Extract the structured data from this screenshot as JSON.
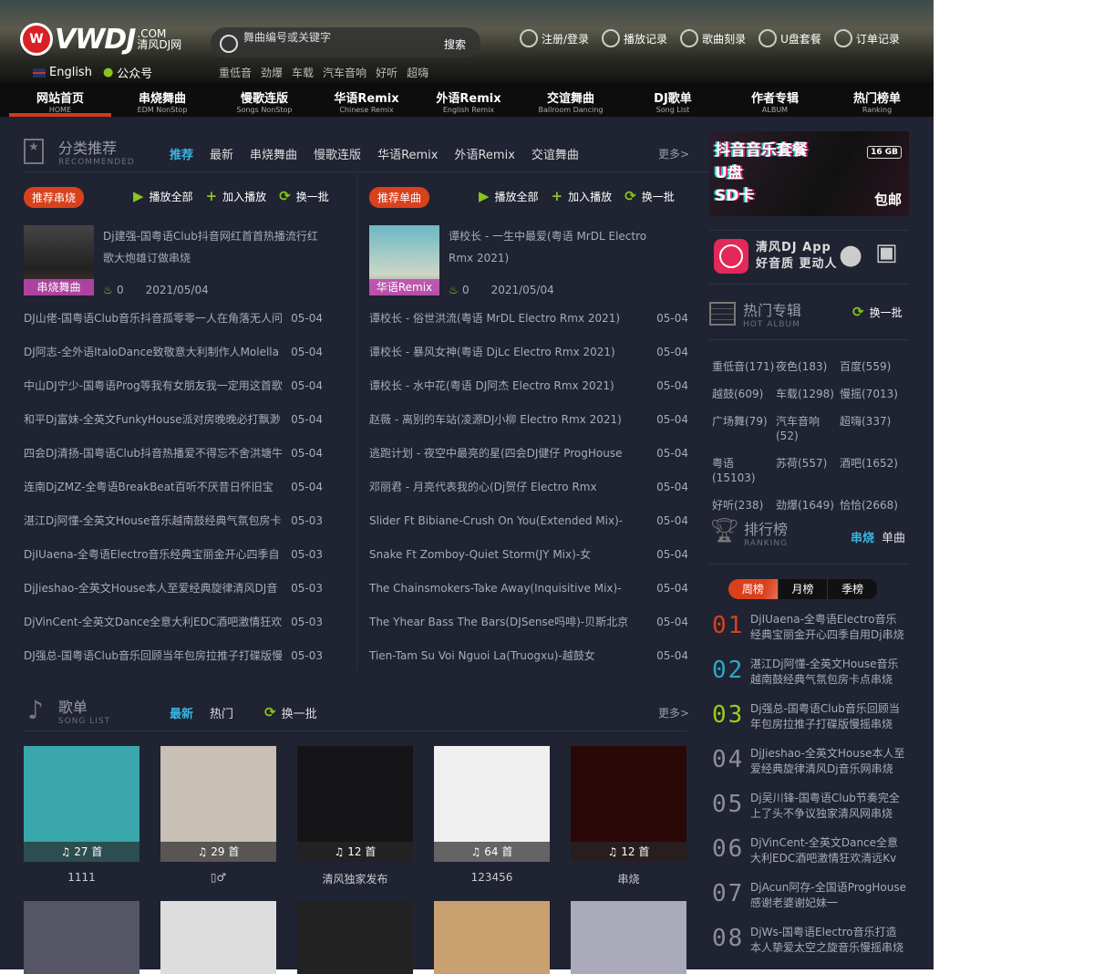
{
  "header": {
    "logo_text": "VWDJ",
    "logo_domain": ".COM",
    "logo_sub": "清风DJ网",
    "english": "English",
    "wechat": "公众号",
    "search": {
      "placeholder": "舞曲编号或关键字",
      "button": "搜索"
    },
    "hot_words": [
      "重低音",
      "劲爆",
      "车载",
      "汽车音响",
      "好听",
      "超嗨"
    ],
    "tools": [
      {
        "icon": "user-icon",
        "label": "注册/登录"
      },
      {
        "icon": "clock-icon",
        "label": "播放记录"
      },
      {
        "icon": "disc-icon",
        "label": "歌曲刻录"
      },
      {
        "icon": "usb-icon",
        "label": "U盘套餐"
      },
      {
        "icon": "order-icon",
        "label": "订单记录"
      }
    ]
  },
  "nav": [
    {
      "label": "网站首页",
      "sub": "HOME",
      "active": true
    },
    {
      "label": "串烧舞曲",
      "sub": "EDM NonStop"
    },
    {
      "label": "慢歌连版",
      "sub": "Songs NonStop"
    },
    {
      "label": "华语Remix",
      "sub": "Chinese Remix"
    },
    {
      "label": "外语Remix",
      "sub": "English Remix"
    },
    {
      "label": "交谊舞曲",
      "sub": "Ballroom Dancing"
    },
    {
      "label": "DJ歌单",
      "sub": "Song List"
    },
    {
      "label": "作者专辑",
      "sub": "ALBUM"
    },
    {
      "label": "热门榜单",
      "sub": "Ranking"
    }
  ],
  "recommend": {
    "title": "分类推荐",
    "subtitle": "RECOMMENDED",
    "tabs": [
      "推荐",
      "最新",
      "串烧舞曲",
      "慢歌连版",
      "华语Remix",
      "外语Remix",
      "交谊舞曲"
    ],
    "more": "更多>",
    "play_all": "播放全部",
    "add_play": "加入播放",
    "refresh": "换一批",
    "left": {
      "badge": "推荐串烧",
      "featured": {
        "title": "Dj建强-国粤语Club抖音网红首首热播流行红歌大炮雄订做串烧",
        "tag": "串烧舞曲",
        "hot": "0",
        "date": "2021/05/04"
      },
      "songs": [
        [
          "DJ山佬-国粤语Club音乐抖音孤零零一人在角落无人问",
          "05-04"
        ],
        [
          "DJ阿志-全外语ItaloDance致敬意大利制作人Molella",
          "05-04"
        ],
        [
          "中山DJ宁少-国粤语Prog等我有女朋友我一定用这首歌",
          "05-04"
        ],
        [
          "和平Dj富妹-全英文FunkyHouse派对房晚晚必打飘渺",
          "05-04"
        ],
        [
          "四会DJ清扬-国粤语Club抖音热播爱不得忘不舍洪塘牛",
          "05-04"
        ],
        [
          "连南DjZMZ-全粤语BreakBeat百听不厌昔日怀旧宝",
          "05-04"
        ],
        [
          "湛江Dj阿懂-全英文House音乐越南鼓经典气氛包房卡",
          "05-03"
        ],
        [
          "DjIUaena-全粤语Electro音乐经典宝丽金开心四季自",
          "05-03"
        ],
        [
          "DjJieshao-全英文House本人至爱经典旋律清风DJ音",
          "05-03"
        ],
        [
          "DjVinCent-全英文Dance全意大利EDC酒吧激情狂欢",
          "05-03"
        ],
        [
          "DJ强总-国粤语Club音乐回顾当年包房拉推子打碟版慢",
          "05-03"
        ]
      ]
    },
    "right": {
      "badge": "推荐单曲",
      "featured": {
        "title": "谭校长 - 一生中最爱(粤语 MrDL Electro Rmx 2021)",
        "tag": "华语Remix",
        "hot": "0",
        "date": "2021/05/04"
      },
      "songs": [
        [
          "谭校长 - 俗世洪流(粤语 MrDL Electro Rmx 2021)",
          "05-04"
        ],
        [
          "谭校长 - 暴风女神(粤语 DjLc Electro Rmx 2021)",
          "05-04"
        ],
        [
          "谭校长 - 水中花(粤语 DJ阿杰 Electro Rmx 2021)",
          "05-04"
        ],
        [
          "赵薇 - 离别的车站(凌源DJ小柳 Electro Rmx 2021)",
          "05-04"
        ],
        [
          "逃跑计划 - 夜空中最亮的星(四会DJ健仔 ProgHouse",
          "05-04"
        ],
        [
          "邓丽君 - 月亮代表我的心(Dj贺仔 Electro Rmx",
          "05-04"
        ],
        [
          "Slider Ft Bibiane-Crush On You(Extended Mix)-",
          "05-04"
        ],
        [
          "Snake Ft Zomboy-Quiet Storm(JY Mix)-女",
          "05-04"
        ],
        [
          "The Chainsmokers-Take Away(Inquisitive Mix)-",
          "05-04"
        ],
        [
          "The Yhear Bass The Bars(DJSense吗啡)-贝斯北京",
          "05-04"
        ],
        [
          "Tien-Tam Su Voi Nguoi La(Truogxu)-越鼓女",
          "05-04"
        ]
      ]
    }
  },
  "songlist": {
    "title": "歌单",
    "subtitle": "SONG LIST",
    "tabs": [
      "最新",
      "热门"
    ],
    "refresh": "换一批",
    "more": "更多>",
    "items": [
      {
        "count": "27 首",
        "name": "1111",
        "color": "#3aa7ad"
      },
      {
        "count": "29 首",
        "name": "▯♂",
        "color": "#c8bfb5"
      },
      {
        "count": "12 首",
        "name": "清风独家发布",
        "color": "#151518"
      },
      {
        "count": "64 首",
        "name": "123456",
        "color": "#f0f0f0"
      },
      {
        "count": "12 首",
        "name": "串烧",
        "color": "#2a0808"
      }
    ],
    "row2_colors": [
      "#556",
      "#ddd",
      "#222",
      "#c9a070",
      "#aab"
    ]
  },
  "sidebar": {
    "banner": {
      "line1": "抖音音乐套餐",
      "line2": "U盘",
      "line3": "SD卡",
      "capacity": "16 GB",
      "ship": "包邮"
    },
    "app": {
      "name": "清风DJ App",
      "slogan": "好音质  更动人"
    },
    "album": {
      "title": "热门专辑",
      "subtitle": "HOT ALBUM",
      "refresh": "换一批",
      "tags": [
        "重低音(171)",
        "夜色(183)",
        "百度(559)",
        "越鼓(609)",
        "车载(1298)",
        "慢摇(7013)",
        "广场舞(79)",
        "汽车音响(52)",
        "超嗨(337)",
        "粤语(15103)",
        "苏荷(557)",
        "酒吧(1652)",
        "好听(238)",
        "劲爆(1649)",
        "恰恰(2668)"
      ]
    },
    "ranking": {
      "title": "排行榜",
      "subtitle": "RANKING",
      "types": [
        "串烧",
        "单曲"
      ],
      "periods": [
        "周榜",
        "月榜",
        "季榜"
      ],
      "items": [
        {
          "num": "01",
          "color": "#d9411c",
          "title": "DjIUaena-全粤语Electro音乐经典宝丽金开心四季自用Dj串烧"
        },
        {
          "num": "02",
          "color": "#2aa8c8",
          "title": "湛江Dj阿懂-全英文House音乐越南鼓经典气氛包房卡点串烧"
        },
        {
          "num": "03",
          "color": "#9acd1a",
          "title": "Dj强总-国粤语Club音乐回顾当年包房拉推子打碟版慢摇串烧"
        },
        {
          "num": "04",
          "color": "#8d8f96",
          "title": "DjJieshao-全英文House本人至爱经典旋律清风Dj音乐网串烧"
        },
        {
          "num": "05",
          "color": "#8d8f96",
          "title": "Dj吴川锋-国粤语Club节奏完全上了头不争议独家清风网串烧"
        },
        {
          "num": "06",
          "color": "#8d8f96",
          "title": "DjVinCent-全英文Dance全意大利EDC酒吧激情狂欢清远Kv"
        },
        {
          "num": "07",
          "color": "#8d8f96",
          "title": "DjAcun阿存-全国语ProgHouse感谢老婆谢妃妹一"
        },
        {
          "num": "08",
          "color": "#8d8f96",
          "title": "DjWs-国粤语Electro音乐打造本人挚爱太空之旋音乐慢摇串烧"
        }
      ]
    }
  }
}
